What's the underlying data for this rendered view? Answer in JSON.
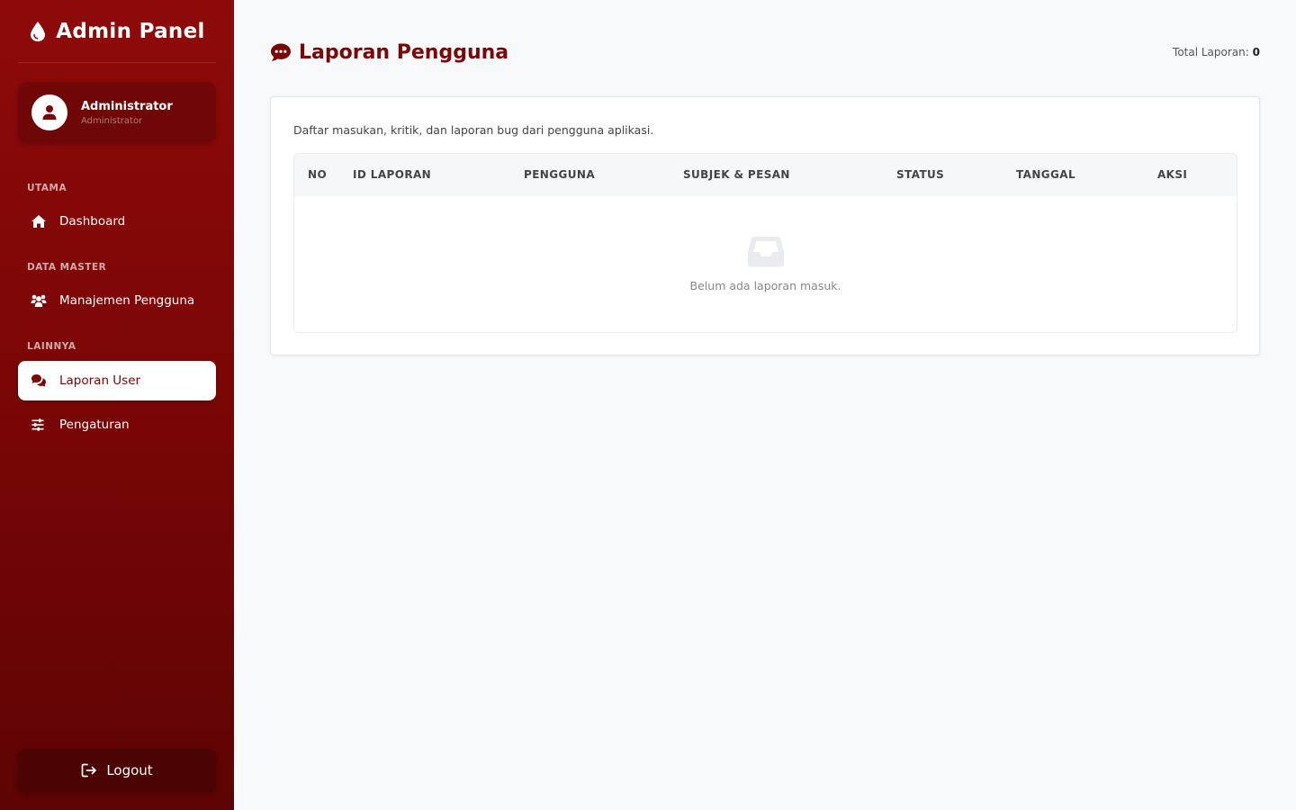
{
  "app": {
    "title": "Admin Panel"
  },
  "user": {
    "name": "Administrator",
    "role": "Administrator"
  },
  "nav": {
    "sections": [
      {
        "label": "UTAMA",
        "items": [
          {
            "label": "Dashboard",
            "icon": "home-icon"
          }
        ]
      },
      {
        "label": "DATA MASTER",
        "items": [
          {
            "label": "Manajemen Pengguna",
            "icon": "users-icon"
          }
        ]
      },
      {
        "label": "LAINNYA",
        "items": [
          {
            "label": "Laporan User",
            "icon": "comments-icon",
            "active": true
          },
          {
            "label": "Pengaturan",
            "icon": "sliders-icon"
          }
        ]
      }
    ],
    "logout_label": "Logout"
  },
  "page": {
    "title": "Laporan Pengguna",
    "total_label": "Total Laporan:",
    "total_value": "0",
    "description": "Daftar masukan, kritik, dan laporan bug dari pengguna aplikasi."
  },
  "table": {
    "columns": [
      "NO",
      "ID LAPORAN",
      "PENGGUNA",
      "SUBJEK & PESAN",
      "STATUS",
      "TANGGAL",
      "AKSI"
    ],
    "rows": [],
    "empty_message": "Belum ada laporan masuk."
  },
  "colors": {
    "brand": "#7a0606",
    "sidebar_top": "#8e0a0a",
    "sidebar_bottom": "#5e0404",
    "background": "#f8f9fb"
  }
}
